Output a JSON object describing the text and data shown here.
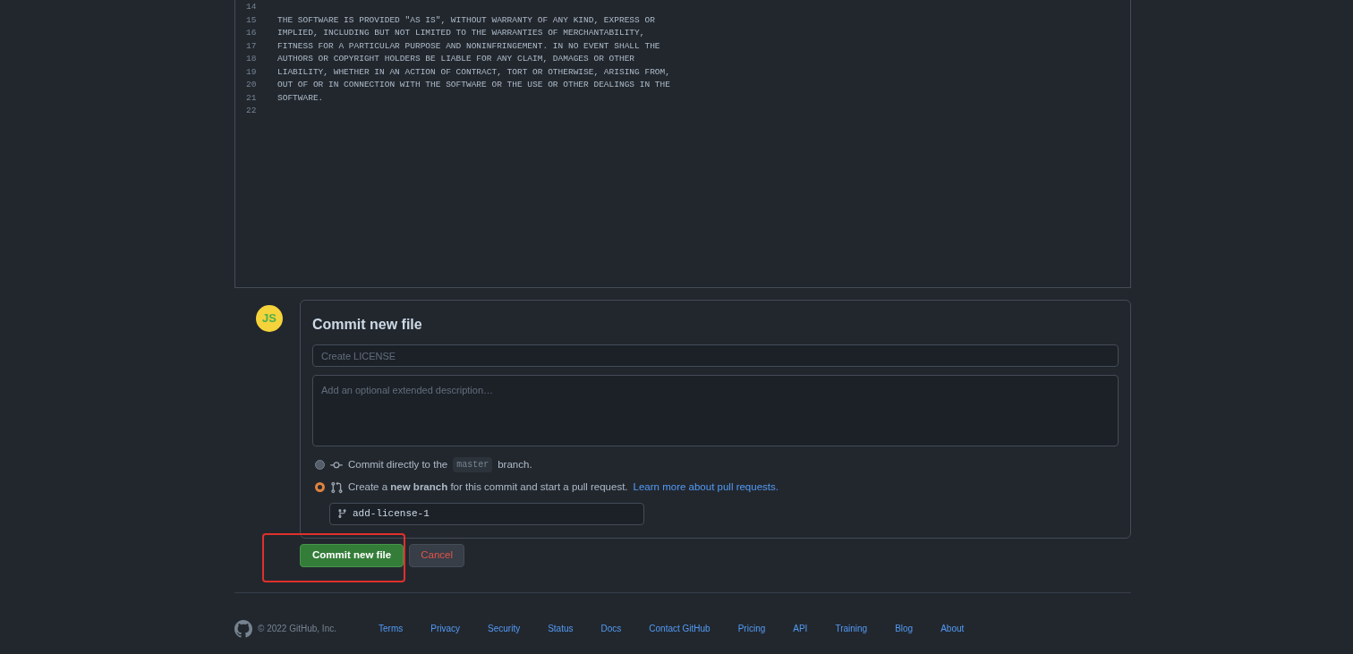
{
  "editor": {
    "lines": [
      {
        "number": "14"
      },
      {
        "number": "15",
        "text": "THE SOFTWARE IS PROVIDED \"AS IS\", WITHOUT WARRANTY OF ANY KIND, EXPRESS OR"
      },
      {
        "number": "16",
        "text": "IMPLIED, INCLUDING BUT NOT LIMITED TO THE WARRANTIES OF MERCHANTABILITY,"
      },
      {
        "number": "17",
        "text": "FITNESS FOR A PARTICULAR PURPOSE AND NONINFRINGEMENT. IN NO EVENT SHALL THE"
      },
      {
        "number": "18",
        "text": "AUTHORS OR COPYRIGHT HOLDERS BE LIABLE FOR ANY CLAIM, DAMAGES OR OTHER"
      },
      {
        "number": "19",
        "text": "LIABILITY, WHETHER IN AN ACTION OF CONTRACT, TORT OR OTHERWISE, ARISING FROM,"
      },
      {
        "number": "20",
        "text": "OUT OF OR IN CONNECTION WITH THE SOFTWARE OR THE USE OR OTHER DEALINGS IN THE"
      },
      {
        "number": "21",
        "text": "SOFTWARE."
      },
      {
        "number": "22"
      }
    ]
  },
  "commit": {
    "avatar_text": "JS",
    "title": "Commit new file",
    "summary": {
      "placeholder": "Create LICENSE"
    },
    "description": {
      "placeholder": "Add an optional extended description…"
    },
    "options": [
      {
        "kind": "direct",
        "selected": false,
        "before": "Commit directly to the",
        "branch": "master",
        "after": "branch."
      },
      {
        "kind": "new_branch",
        "selected": true,
        "text": "Create a **new branch** for this commit and start a pull request.",
        "link": "Learn more about pull requests."
      }
    ],
    "branch_name": "add-license-1",
    "buttons": {
      "commit": "Commit new file",
      "cancel": "Cancel"
    }
  },
  "footer": {
    "copyright": "© 2022 GitHub, Inc.",
    "links": [
      "Terms",
      "Privacy",
      "Security",
      "Status",
      "Docs",
      "Contact GitHub",
      "Pricing",
      "API",
      "Training",
      "Blog",
      "About"
    ]
  }
}
